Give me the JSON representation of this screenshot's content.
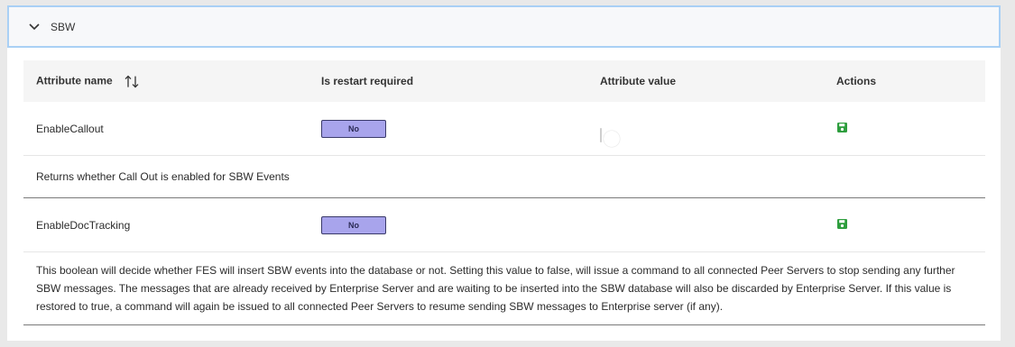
{
  "section": {
    "title": "SBW",
    "expanded": true,
    "chevron_icon": "chevron-down-icon"
  },
  "table": {
    "columns": {
      "attribute_name": "Attribute name",
      "is_restart_required": "Is restart required",
      "attribute_value": "Attribute value",
      "actions": "Actions"
    },
    "sort_icon": "sort-arrows-icon",
    "rows": [
      {
        "name": "EnableCallout",
        "restart_required": "No",
        "value_enabled": false,
        "action_icon": "save-icon",
        "description": "Returns whether Call Out is enabled for SBW Events"
      },
      {
        "name": "EnableDocTracking",
        "restart_required": "No",
        "value_enabled": true,
        "action_icon": "save-icon",
        "description": "This boolean will decide whether FES will insert SBW events into the database or not. Setting this value to false, will issue a command to all connected Peer Servers to stop sending any further SBW messages. The messages that are already received by Enterprise Server and are waiting to be inserted into the SBW database will also be discarded by Enterprise Server. If this value is restored to true, a command will again be issued to all connected Peer Servers to resume sending SBW messages to Enterprise server (if any)."
      }
    ]
  },
  "colors": {
    "header_border": "#a9d0f5",
    "badge_bg": "#a8a4ec",
    "toggle_on": "#1e88e5",
    "save_icon": "#2e9e3e"
  }
}
